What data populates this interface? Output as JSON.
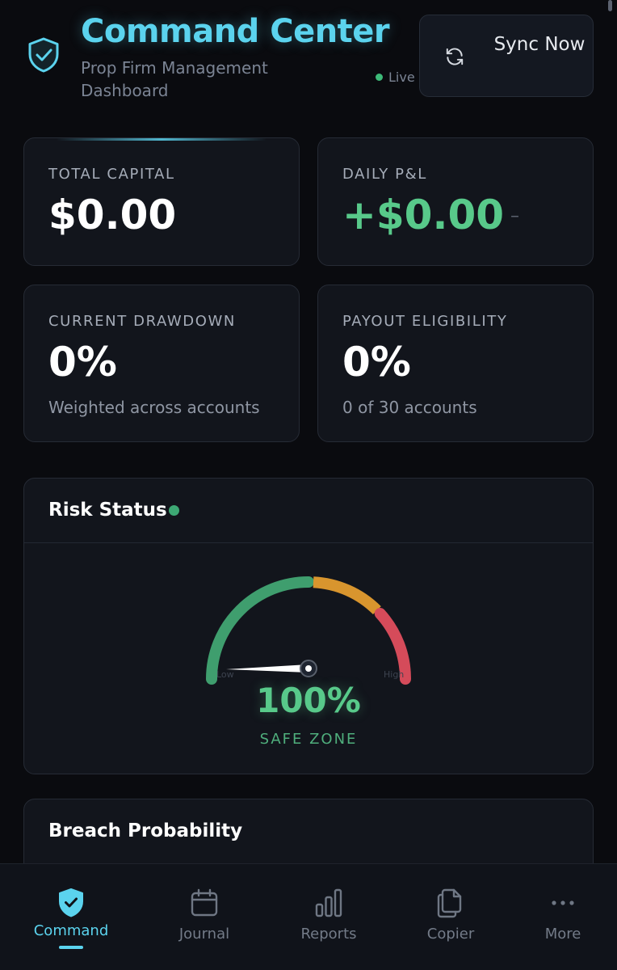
{
  "header": {
    "shield_icon": "shield-check-icon",
    "title": "Command Center",
    "subtitle": "Prop Firm Management Dashboard",
    "live_label": "Live",
    "sync_icon": "refresh-icon",
    "sync_label": "Sync Now"
  },
  "stats": {
    "total_capital": {
      "label": "TOTAL CAPITAL",
      "value": "$0.00"
    },
    "daily_pnl": {
      "label": "DAILY P&L",
      "value": "+$0.00",
      "change": "–"
    },
    "current_drawdown": {
      "label": "CURRENT DRAWDOWN",
      "value": "0%",
      "sub": "Weighted across accounts"
    },
    "payout_eligibility": {
      "label": "PAYOUT ELIGIBILITY",
      "value": "0%",
      "sub": "0 of 30 accounts"
    }
  },
  "risk": {
    "title": "Risk Status",
    "gauge_low_label": "Low",
    "gauge_high_label": "High",
    "gauge_value_fraction": 0.0,
    "percent": "100%",
    "zone": "SAFE ZONE"
  },
  "breach": {
    "title": "Breach Probability"
  },
  "colors": {
    "accent": "#5bd3ee",
    "positive": "#58c98a",
    "gauge_safe": "#3f9e6e",
    "gauge_warn": "#d8952e",
    "gauge_danger": "#d54b5a",
    "background": "#0a0b0f"
  },
  "nav": {
    "items": [
      {
        "label": "Command",
        "icon": "shield-check-icon",
        "active": true
      },
      {
        "label": "Journal",
        "icon": "calendar-icon",
        "active": false
      },
      {
        "label": "Reports",
        "icon": "bar-chart-icon",
        "active": false
      },
      {
        "label": "Copier",
        "icon": "copy-icon",
        "active": false
      },
      {
        "label": "More",
        "icon": "more-horizontal-icon",
        "active": false
      }
    ]
  }
}
